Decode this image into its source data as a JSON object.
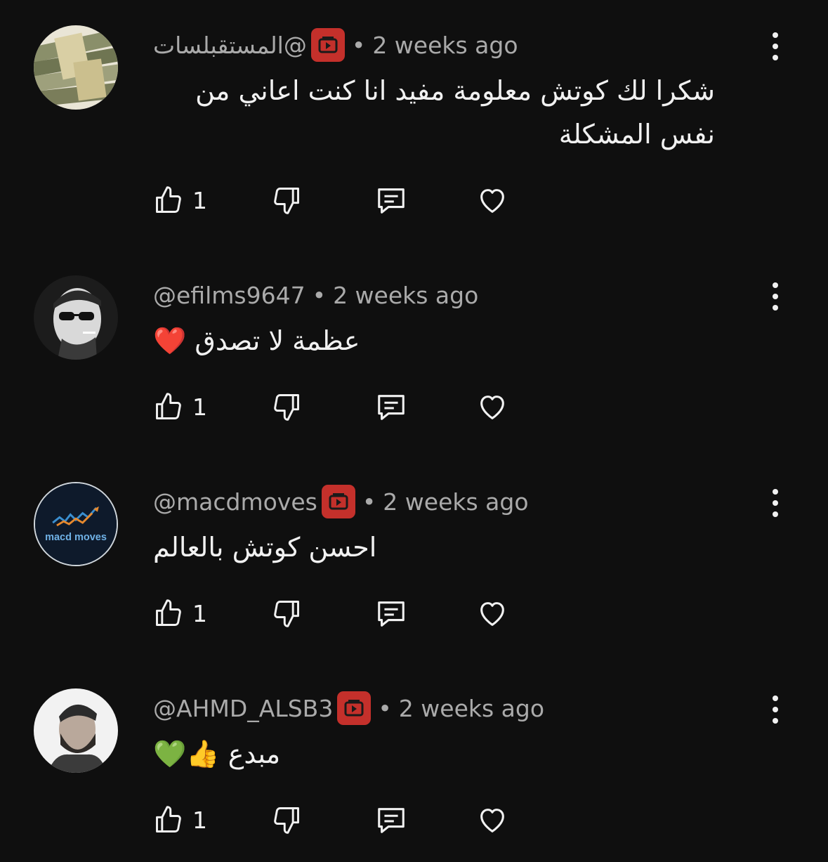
{
  "comments": [
    {
      "handle": "@المستقبلسات",
      "has_badge": true,
      "separator": "•",
      "time": "2 weeks ago",
      "text": "شكرا لك  كوتش معلومة مفيد انا كنت اعاني من نفس المشكلة",
      "likes": "1",
      "avatar_icon": "money-stack-avatar"
    },
    {
      "handle": "@efilms9647",
      "has_badge": false,
      "separator": "•",
      "time": "2 weeks ago",
      "text": "عظمة لا تصدق ❤️",
      "likes": "1",
      "avatar_icon": "man-sunglasses-avatar"
    },
    {
      "handle": "@macdmoves",
      "has_badge": true,
      "separator": "•",
      "time": "2 weeks ago",
      "text": "احسن كوتش بالعالم",
      "likes": "1",
      "avatar_icon": "macd-moves-logo-avatar",
      "avatar_text": "macd moves"
    },
    {
      "handle": "@AHMD_ALSB3",
      "has_badge": true,
      "separator": "•",
      "time": "2 weeks ago",
      "text": "مبدع 👍💚",
      "likes": "1",
      "avatar_icon": "bearded-man-avatar"
    }
  ],
  "icons": {
    "like": "thumbs-up-icon",
    "dislike": "thumbs-down-icon",
    "reply": "reply-comment-icon",
    "heart": "heart-icon",
    "more": "more-vertical-icon",
    "badge": "youtube-member-badge-icon"
  },
  "colors": {
    "background": "#0f0f0f",
    "text": "#f1f1f1",
    "meta": "#aaaaaa",
    "badge": "#c4302b"
  }
}
